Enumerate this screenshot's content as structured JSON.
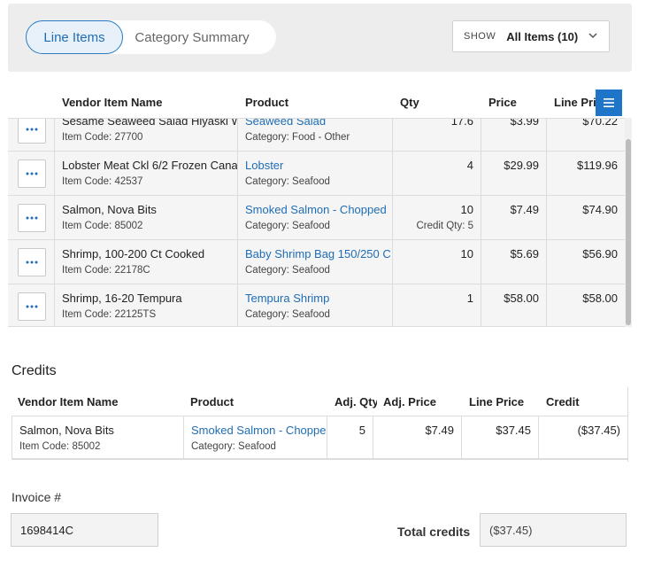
{
  "tabs": [
    {
      "label": "Line Items",
      "active": true
    },
    {
      "label": "Category Summary",
      "active": false
    }
  ],
  "show": {
    "label": "SHOW",
    "value": "All Items (10)"
  },
  "columns": {
    "vendor_item_name": "Vendor Item Name",
    "product": "Product",
    "qty": "Qty",
    "price": "Price",
    "line_price": "Line Price"
  },
  "rows": [
    {
      "name": "Sesame Seaweed Salad Hiyaski W",
      "code": "Item Code: 27700",
      "product": "Seaweed Salad",
      "category": "Category: Food - Other",
      "qty": "17.6",
      "credit_qty": "",
      "price": "$3.99",
      "line_price": "$70.22"
    },
    {
      "name": "Lobster Meat Ckl 6/2 Frozen Cana",
      "code": "Item Code: 42537",
      "product": "Lobster",
      "category": "Category: Seafood",
      "qty": "4",
      "credit_qty": "",
      "price": "$29.99",
      "line_price": "$119.96"
    },
    {
      "name": "Salmon, Nova Bits",
      "code": "Item Code: 85002",
      "product": "Smoked Salmon - Chopped",
      "category": "Category: Seafood",
      "qty": "10",
      "credit_qty": "Credit Qty: 5",
      "price": "$7.49",
      "line_price": "$74.90"
    },
    {
      "name": "Shrimp, 100-200 Ct Cooked",
      "code": "Item Code: 22178C",
      "product": "Baby Shrimp Bag 150/250 C",
      "category": "Category: Seafood",
      "qty": "10",
      "credit_qty": "",
      "price": "$5.69",
      "line_price": "$56.90"
    },
    {
      "name": "Shrimp, 16-20 Tempura",
      "code": "Item Code: 22125TS",
      "product": "Tempura Shrimp",
      "category": "Category: Seafood",
      "qty": "1",
      "credit_qty": "",
      "price": "$58.00",
      "line_price": "$58.00"
    }
  ],
  "credits": {
    "title": "Credits",
    "columns": {
      "vendor_item_name": "Vendor Item Name",
      "product": "Product",
      "adj_qty": "Adj. Qty",
      "adj_price": "Adj. Price",
      "line_price": "Line Price",
      "credit": "Credit"
    },
    "rows": [
      {
        "name": "Salmon, Nova Bits",
        "code": "Item Code: 85002",
        "product": "Smoked Salmon - Choppe",
        "category": "Category: Seafood",
        "adj_qty": "5",
        "adj_price": "$7.49",
        "line_price": "$37.45",
        "credit": "($37.45)"
      }
    ]
  },
  "invoice": {
    "label": "Invoice #",
    "value": "1698414C"
  },
  "total_credits": {
    "label": "Total credits",
    "value": "($37.45)"
  },
  "colors": {
    "accent": "#1f6db5",
    "menu_button": "#1f75c7"
  }
}
